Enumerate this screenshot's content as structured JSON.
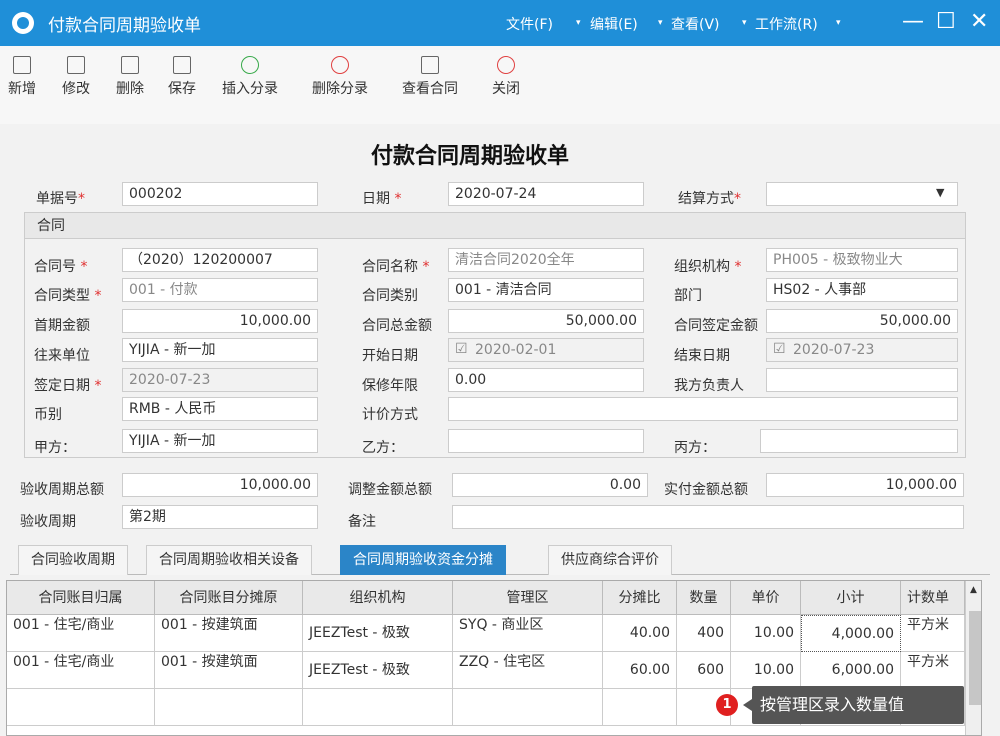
{
  "window": {
    "title": "付款合同周期验收单",
    "menus": [
      "文件(F)",
      "编辑(E)",
      "查看(V)",
      "工作流(R)"
    ]
  },
  "toolbar": {
    "buttons": [
      "新增",
      "修改",
      "删除",
      "保存",
      "插入分录",
      "删除分录",
      "查看合同",
      "关闭"
    ]
  },
  "form": {
    "title": "付款合同周期验收单",
    "bill_no_label": "单据号",
    "bill_no": "000202",
    "date_label": "日期",
    "date": "2020-07-24",
    "settle_label": "结算方式",
    "settle": "",
    "group_title": "合同",
    "contract_no_label": "合同号",
    "contract_no": "（2020）120200007",
    "contract_name_label": "合同名称",
    "contract_name": "清洁合同2020全年",
    "org_label": "组织机构",
    "org": "PH005 - 极致物业大",
    "contract_type_label": "合同类型",
    "contract_type": "001 - 付款",
    "contract_cat_label": "合同类别",
    "contract_cat": "001 - 清洁合同",
    "dept_label": "部门",
    "dept": "HS02 - 人事部",
    "first_amt_label": "首期金额",
    "first_amt": "10,000.00",
    "total_amt_label": "合同总金额",
    "total_amt": "50,000.00",
    "signed_amt_label": "合同签定金额",
    "signed_amt": "50,000.00",
    "partner_label": "往来单位",
    "partner": "YIJIA - 新一加",
    "start_label": "开始日期",
    "start": "2020-02-01",
    "end_label": "结束日期",
    "end": "2020-07-23",
    "sign_date_label": "签定日期",
    "sign_date": "2020-07-23",
    "warranty_label": "保修年限",
    "warranty": "0.00",
    "owner_label": "我方负责人",
    "owner": "",
    "currency_label": "币别",
    "currency": "RMB - 人民币",
    "pricing_label": "计价方式",
    "pricing": "",
    "party_a_label": "甲方：",
    "party_a": "YIJIA - 新一加",
    "party_b_label": "乙方：",
    "party_b": "",
    "party_c_label": "丙方：",
    "party_c": "",
    "period_total_label": "验收周期总额",
    "period_total": "10,000.00",
    "adjust_total_label": "调整金额总额",
    "adjust_total": "0.00",
    "paid_total_label": "实付金额总额",
    "paid_total": "10,000.00",
    "period_label": "验收周期",
    "period": "第2期",
    "remark_label": "备注",
    "remark": ""
  },
  "tabs": [
    "合同验收周期",
    "合同周期验收相关设备",
    "合同周期验收资金分摊",
    "供应商综合评价"
  ],
  "grid": {
    "headers": [
      "合同账目归属",
      "合同账目分摊原",
      "组织机构",
      "管理区",
      "分摊比",
      "数量",
      "单价",
      "小计",
      "计数单"
    ],
    "rows": [
      [
        "001 - 住宅/商业",
        "001 - 按建筑面",
        "JEEZTest - 极致",
        "SYQ - 商业区",
        "40.00",
        "400",
        "10.00",
        "4,000.00",
        "平方米"
      ],
      [
        "001 - 住宅/商业",
        "001 - 按建筑面",
        "JEEZTest - 极致",
        "ZZQ - 住宅区",
        "60.00",
        "600",
        "10.00",
        "6,000.00",
        "平方米"
      ]
    ]
  },
  "tooltip": {
    "badge": "1",
    "text": "按管理区录入数量值"
  }
}
